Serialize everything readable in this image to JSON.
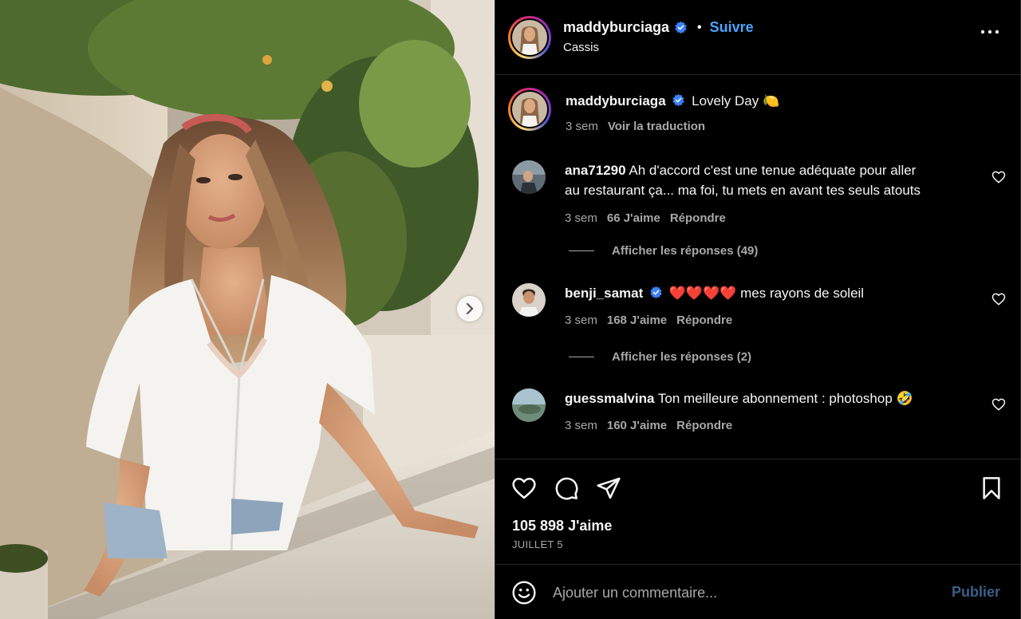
{
  "post": {
    "username": "maddyburciaga",
    "follow_label": "Suivre",
    "separator": "•",
    "location": "Cassis",
    "more_icon": "more-horizontal-icon"
  },
  "caption": {
    "username": "maddyburciaga",
    "text": "Lovely Day 🍋",
    "time": "3 sem",
    "translate_label": "Voir la traduction"
  },
  "comments": [
    {
      "username": "ana71290",
      "text_line1": "Ah d'accord c'est une tenue adéquate pour aller",
      "text_line2": "au restaurant ça... ma foi, tu mets en avant tes seuls atouts",
      "time": "3 sem",
      "likes": "66 J'aime",
      "reply_label": "Répondre",
      "replies_label": "Afficher les réponses (49)"
    },
    {
      "username": "benji_samat",
      "text": "❤️❤️❤️❤️ mes rayons de soleil",
      "time": "3 sem",
      "likes": "168 J'aime",
      "reply_label": "Répondre",
      "replies_label": "Afficher les réponses (2)"
    },
    {
      "username": "guessmalvina",
      "text": "Ton meilleure abonnement : photoshop 🤣",
      "time": "3 sem",
      "likes": "160 J'aime",
      "reply_label": "Répondre"
    }
  ],
  "actions": {
    "like_icon": "heart-icon",
    "comment_icon": "comment-icon",
    "share_icon": "send-icon",
    "save_icon": "bookmark-icon",
    "likes_count": "105 898 J'aime",
    "date": "JUILLET 5"
  },
  "composer": {
    "placeholder": "Ajouter un commentaire...",
    "publish_label": "Publier",
    "emoji_icon": "emoji-icon"
  },
  "colors": {
    "background": "#000000",
    "text": "#f5f5f5",
    "secondary": "#a8a8a8",
    "link": "#4aa3ff",
    "verified": "#3b82f6",
    "publish_disabled": "#3a5f88"
  }
}
